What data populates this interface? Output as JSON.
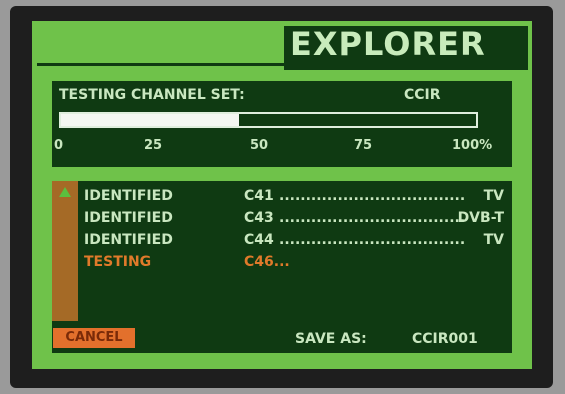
{
  "screen": {
    "title": "EXPLORER"
  },
  "testing_panel": {
    "label": "TESTING CHANNEL SET:",
    "channel_set": "CCIR",
    "progress_percent": 43,
    "scale_labels": [
      "0",
      "25",
      "50",
      "75",
      "100%"
    ]
  },
  "results": {
    "rows": [
      {
        "status": "IDENTIFIED",
        "channel": "C41",
        "dots": "..................................................",
        "type": "TV"
      },
      {
        "status": "IDENTIFIED",
        "channel": "C43",
        "dots": "..................................................",
        "type": "DVB-T"
      },
      {
        "status": "IDENTIFIED",
        "channel": "C44",
        "dots": "..................................................",
        "type": "TV"
      },
      {
        "status": "TESTING",
        "channel": "C46...",
        "dots": "",
        "type": ""
      }
    ]
  },
  "footer": {
    "cancel_label": "CANCEL",
    "save_as_label": "SAVE AS:",
    "save_as_value": "CCIR001"
  },
  "colors": {
    "screen_bg": "#6fc24a",
    "panel_bg": "#0f3a12",
    "text": "#c9e7c0",
    "testing_text": "#e07a2a",
    "cancel_bg": "#e3702c",
    "scrollbar": "#a56a26"
  }
}
